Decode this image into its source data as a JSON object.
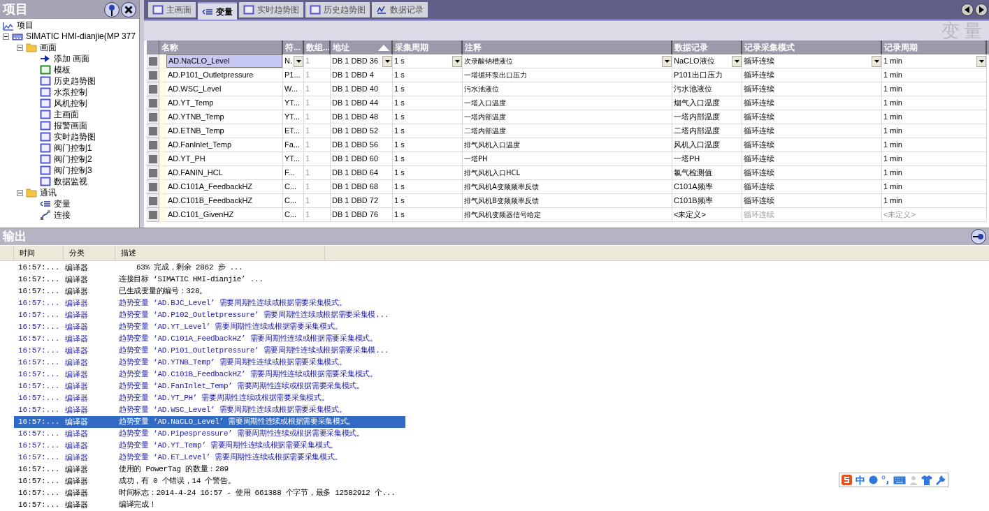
{
  "project_panel": {
    "title": "项目",
    "tree": [
      {
        "label": "项目",
        "kind": "chart"
      },
      {
        "label": "SIMATIC HMI-dianjie(MP 377",
        "kind": "device",
        "expanded": true,
        "children": [
          {
            "label": "画面",
            "kind": "folder",
            "expanded": true,
            "children": [
              {
                "label": "添加 画面",
                "kind": "add"
              },
              {
                "label": "模板",
                "kind": "template"
              },
              {
                "label": "历史趋势图",
                "kind": "screen"
              },
              {
                "label": "水泵控制",
                "kind": "screen"
              },
              {
                "label": "风机控制",
                "kind": "screen"
              },
              {
                "label": "主画面",
                "kind": "screen"
              },
              {
                "label": "报警画面",
                "kind": "screen"
              },
              {
                "label": "实时趋势图",
                "kind": "screen"
              },
              {
                "label": "阀门控制1",
                "kind": "screen"
              },
              {
                "label": "阀门控制2",
                "kind": "screen"
              },
              {
                "label": "阀门控制3",
                "kind": "screen"
              },
              {
                "label": "数据监视",
                "kind": "screen"
              }
            ]
          },
          {
            "label": "通讯",
            "kind": "folder",
            "expanded": true,
            "children": [
              {
                "label": "变量",
                "kind": "tag"
              },
              {
                "label": "连接",
                "kind": "connection"
              }
            ]
          }
        ]
      }
    ]
  },
  "editor": {
    "tabs": [
      {
        "label": "主画面",
        "kind": "screen",
        "selected": false
      },
      {
        "label": "变量",
        "kind": "tag",
        "selected": true
      },
      {
        "label": "实时趋势图",
        "kind": "screen",
        "selected": false
      },
      {
        "label": "历史趋势图",
        "kind": "screen",
        "selected": false
      },
      {
        "label": "数据记录",
        "kind": "trend",
        "selected": false
      }
    ],
    "page_title": "变量",
    "columns": [
      {
        "label": "名称",
        "sorted": false
      },
      {
        "label": "符...",
        "sorted": false
      },
      {
        "label": "数组...",
        "sorted": false
      },
      {
        "label": "地址",
        "sorted": true
      },
      {
        "label": "采集周期",
        "sorted": false
      },
      {
        "label": "注释",
        "sorted": false
      },
      {
        "label": "数据记录",
        "sorted": false
      },
      {
        "label": "记录采集模式",
        "sorted": false
      },
      {
        "label": "记录周期",
        "sorted": false
      }
    ],
    "rows": [
      {
        "name": "AD.NaCLO_Level",
        "symbol": "N.",
        "array": "1",
        "address": "DB 1 DBD 36",
        "cycle": "1 s",
        "comment": "次录酸钠槽液位",
        "log": "NaCLO液位",
        "log_mode": "循环连续",
        "log_cycle": "1 min",
        "selected": true,
        "log_disabled": false
      },
      {
        "name": "AD.P101_Outletpressure",
        "symbol": "P1...",
        "array": "1",
        "address": "DB 1 DBD 4",
        "cycle": "1 s",
        "comment": "一塔循环泵出口压力",
        "log": "P101出口压力",
        "log_mode": "循环连续",
        "log_cycle": "1 min",
        "selected": false,
        "log_disabled": false
      },
      {
        "name": "AD.WSC_Level",
        "symbol": "W...",
        "array": "1",
        "address": "DB 1 DBD 40",
        "cycle": "1 s",
        "comment": "污水池液位",
        "log": "污水池液位",
        "log_mode": "循环连续",
        "log_cycle": "1 min",
        "selected": false,
        "log_disabled": false
      },
      {
        "name": "AD.YT_Temp",
        "symbol": "YT...",
        "array": "1",
        "address": "DB 1 DBD 44",
        "cycle": "1 s",
        "comment": "一塔入口温度",
        "log": "烟气入口温度",
        "log_mode": "循环连续",
        "log_cycle": "1 min",
        "selected": false,
        "log_disabled": false
      },
      {
        "name": "AD.YTNB_Temp",
        "symbol": "YT...",
        "array": "1",
        "address": "DB 1 DBD 48",
        "cycle": "1 s",
        "comment": "一塔内部温度",
        "log": "一塔内部温度",
        "log_mode": "循环连续",
        "log_cycle": "1 min",
        "selected": false,
        "log_disabled": false
      },
      {
        "name": "AD.ETNB_Temp",
        "symbol": "ET...",
        "array": "1",
        "address": "DB 1 DBD 52",
        "cycle": "1 s",
        "comment": "二塔内部温度",
        "log": "二塔内部温度",
        "log_mode": "循环连续",
        "log_cycle": "1 min",
        "selected": false,
        "log_disabled": false
      },
      {
        "name": "AD.FanInlet_Temp",
        "symbol": "Fa...",
        "array": "1",
        "address": "DB 1 DBD 56",
        "cycle": "1 s",
        "comment": "排气风机入口温度",
        "log": "风机入口温度",
        "log_mode": "循环连续",
        "log_cycle": "1 min",
        "selected": false,
        "log_disabled": false
      },
      {
        "name": "AD.YT_PH",
        "symbol": "YT...",
        "array": "1",
        "address": "DB 1 DBD 60",
        "cycle": "1 s",
        "comment": "一塔PH",
        "log": "一塔PH",
        "log_mode": "循环连续",
        "log_cycle": "1 min",
        "selected": false,
        "log_disabled": false
      },
      {
        "name": "AD.FANIN_HCL",
        "symbol": "F...",
        "array": "1",
        "address": "DB 1 DBD 64",
        "cycle": "1 s",
        "comment": "排气风机入口HCL",
        "log": "氯气检测值",
        "log_mode": "循环连续",
        "log_cycle": "1 min",
        "selected": false,
        "log_disabled": false
      },
      {
        "name": "AD.C101A_FeedbackHZ",
        "symbol": "C...",
        "array": "1",
        "address": "DB 1 DBD 68",
        "cycle": "1 s",
        "comment": "排气风机A变频频率反馈",
        "log": "C101A频率",
        "log_mode": "循环连续",
        "log_cycle": "1 min",
        "selected": false,
        "log_disabled": false
      },
      {
        "name": "AD.C101B_FeedbackHZ",
        "symbol": "C...",
        "array": "1",
        "address": "DB 1 DBD 72",
        "cycle": "1 s",
        "comment": "排气风机B变频频率反馈",
        "log": "C101B频率",
        "log_mode": "循环连续",
        "log_cycle": "1 min",
        "selected": false,
        "log_disabled": false
      },
      {
        "name": "AD.C101_GivenHZ",
        "symbol": "C...",
        "array": "1",
        "address": "DB 1 DBD 76",
        "cycle": "1 s",
        "comment": "排气风机变频器信号给定",
        "log": "<未定义>",
        "log_mode": "循环连续",
        "log_cycle": "<未定义>",
        "selected": false,
        "log_disabled": true
      }
    ]
  },
  "output": {
    "title": "输出",
    "columns": [
      "时间",
      "分类",
      "描述"
    ],
    "entries": [
      {
        "time": "16:57:...",
        "category": "编译器",
        "text": "63% 完成，剩余 2862 步 ...",
        "kind": "progress",
        "selected": false
      },
      {
        "time": "16:57:...",
        "category": "编译器",
        "text": "连接目标 ‘SIMATIC HMI-dianjie’ ...",
        "kind": "info",
        "selected": false
      },
      {
        "time": "16:57:...",
        "category": "编译器",
        "text": "已生成变量的编号：328。",
        "kind": "info",
        "selected": false
      },
      {
        "time": "16:57:...",
        "category": "编译器",
        "text": "趋势变量 ‘AD.BJC_Level’ 需要周期性连续或根据需要采集模式。",
        "kind": "warning",
        "selected": false
      },
      {
        "time": "16:57:...",
        "category": "编译器",
        "text": "趋势变量 ‘AD.P102_Outletpressure’ 需要周期性连续或根据需要采集模...",
        "kind": "warning",
        "selected": false
      },
      {
        "time": "16:57:...",
        "category": "编译器",
        "text": "趋势变量 ‘AD.YT_Level’ 需要周期性连续或根据需要采集模式。",
        "kind": "warning",
        "selected": false
      },
      {
        "time": "16:57:...",
        "category": "编译器",
        "text": "趋势变量 ‘AD.C101A_FeedbackHZ’ 需要周期性连续或根据需要采集模式。",
        "kind": "warning",
        "selected": false
      },
      {
        "time": "16:57:...",
        "category": "编译器",
        "text": "趋势变量 ‘AD.P101_Outletpressure’ 需要周期性连续或根据需要采集模...",
        "kind": "warning",
        "selected": false
      },
      {
        "time": "16:57:...",
        "category": "编译器",
        "text": "趋势变量 ‘AD.YTNB_Temp’ 需要周期性连续或根据需要采集模式。",
        "kind": "warning",
        "selected": false
      },
      {
        "time": "16:57:...",
        "category": "编译器",
        "text": "趋势变量 ‘AD.C101B_FeedbackHZ’ 需要周期性连续或根据需要采集模式。",
        "kind": "warning",
        "selected": false
      },
      {
        "time": "16:57:...",
        "category": "编译器",
        "text": "趋势变量 ‘AD.FanInlet_Temp’ 需要周期性连续或根据需要采集模式。",
        "kind": "warning",
        "selected": false
      },
      {
        "time": "16:57:...",
        "category": "编译器",
        "text": "趋势变量 ‘AD.YT_PH’ 需要周期性连续或根据需要采集模式。",
        "kind": "warning",
        "selected": false
      },
      {
        "time": "16:57:...",
        "category": "编译器",
        "text": "趋势变量 ‘AD.WSC_Level’ 需要周期性连续或根据需要采集模式。",
        "kind": "warning",
        "selected": false
      },
      {
        "time": "16:57:...",
        "category": "编译器",
        "text": "趋势变量 ‘AD.NaCLO_Level’ 需要周期性连续或根据需要采集模式。",
        "kind": "warning",
        "selected": true
      },
      {
        "time": "16:57:...",
        "category": "编译器",
        "text": "趋势变量 ‘AD.Pipespressure’ 需要周期性连续或根据需要采集模式。",
        "kind": "warning",
        "selected": false
      },
      {
        "time": "16:57:...",
        "category": "编译器",
        "text": "趋势变量 ‘AD.YT_Temp’ 需要周期性连续或根据需要采集模式。",
        "kind": "warning",
        "selected": false
      },
      {
        "time": "16:57:...",
        "category": "编译器",
        "text": "趋势变量 ‘AD.ET_Level’ 需要周期性连续或根据需要采集模式。",
        "kind": "warning",
        "selected": false
      },
      {
        "time": "16:57:...",
        "category": "编译器",
        "text": "使用的 PowerTag 的数量：289",
        "kind": "info",
        "selected": false
      },
      {
        "time": "16:57:...",
        "category": "编译器",
        "text": "成功，有 0 个错误，14 个警告。",
        "kind": "info",
        "selected": false
      },
      {
        "time": "16:57:...",
        "category": "编译器",
        "text": "时间标志：2014-4-24 16:57 - 使用 661388 个字节，最多 12582912 个...",
        "kind": "info",
        "selected": false
      },
      {
        "time": "16:57:...",
        "category": "编译器",
        "text": "编译完成！",
        "kind": "info",
        "selected": false
      }
    ]
  },
  "ime_bar": {
    "mode": "中"
  }
}
